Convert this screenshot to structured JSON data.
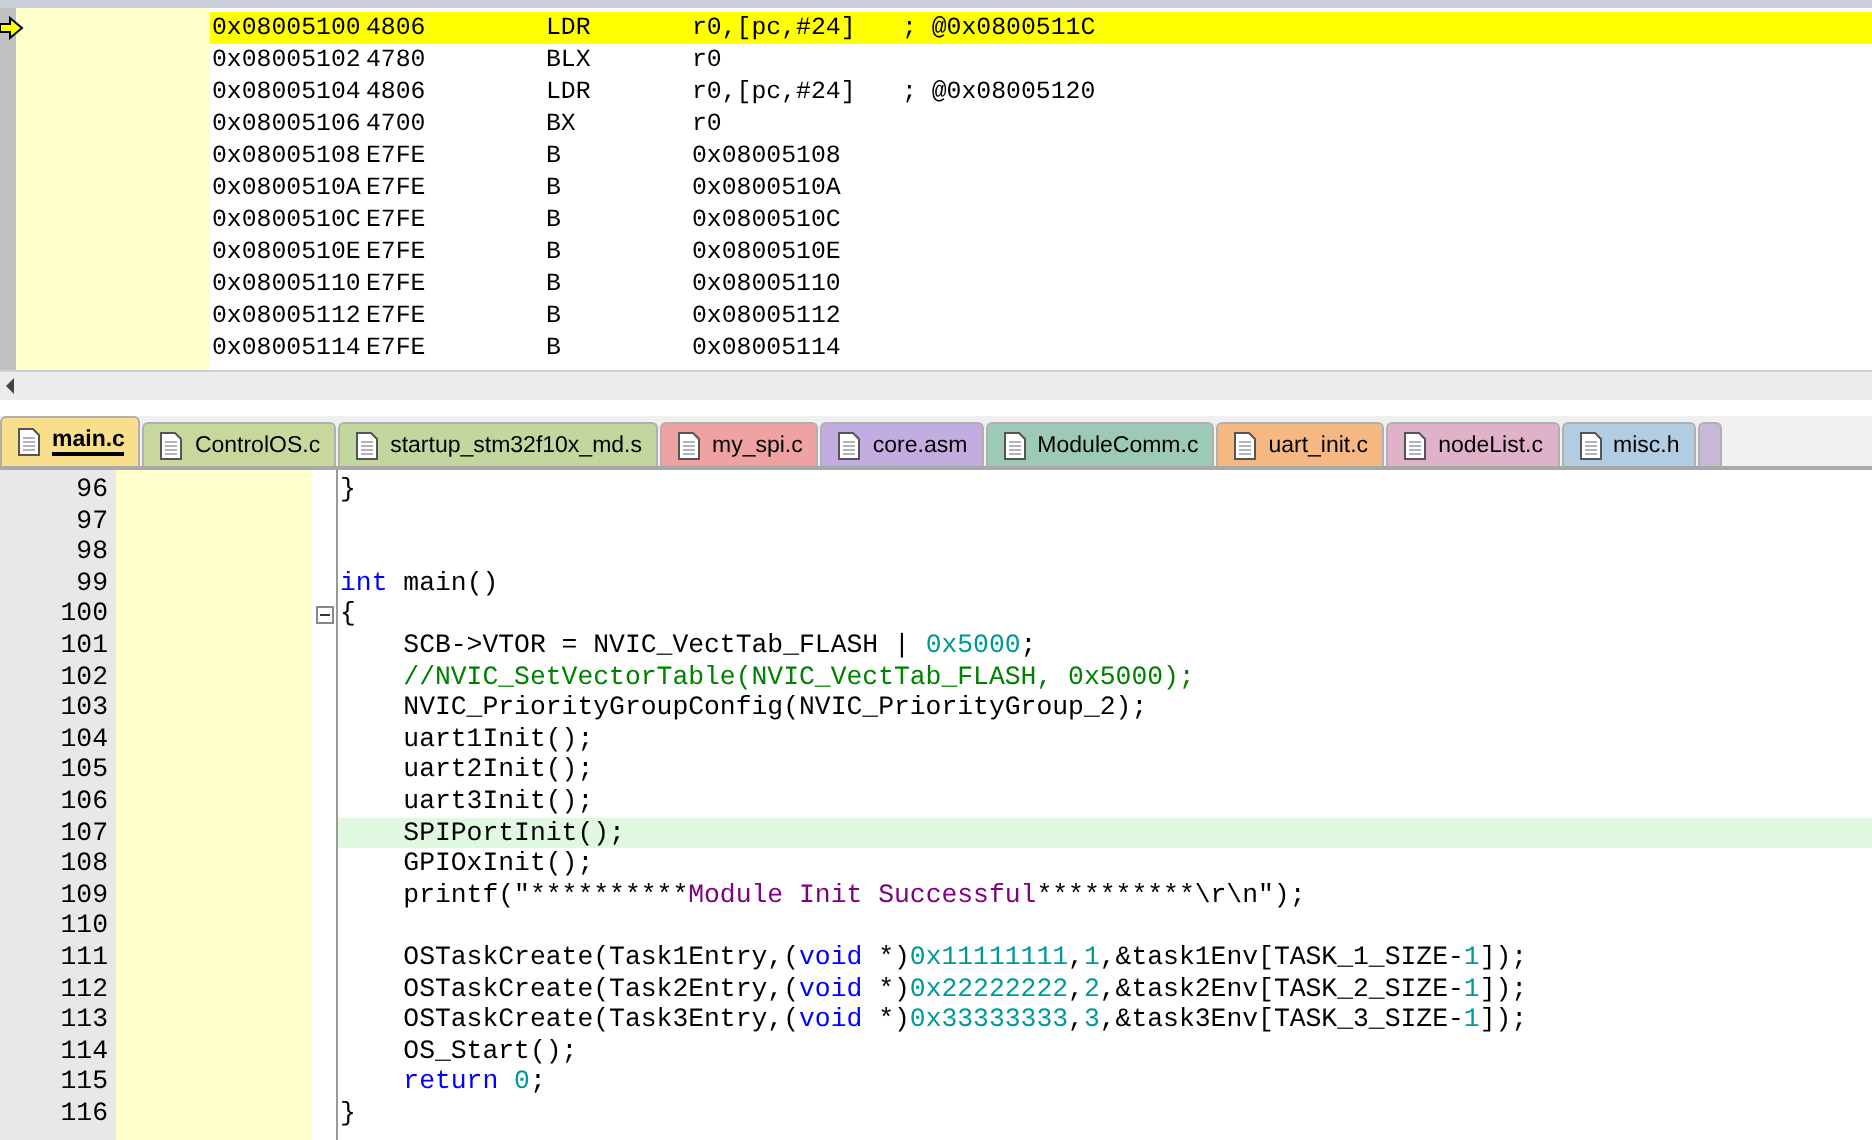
{
  "disassembly": {
    "rows": [
      {
        "address": "0x08005100",
        "opcode": "4806",
        "mnemonic": "LDR",
        "operands": "r0,[pc,#24]",
        "comment": "; @0x0800511C",
        "current": true
      },
      {
        "address": "0x08005102",
        "opcode": "4780",
        "mnemonic": "BLX",
        "operands": "r0",
        "current": false
      },
      {
        "address": "0x08005104",
        "opcode": "4806",
        "mnemonic": "LDR",
        "operands": "r0,[pc,#24]",
        "comment": "; @0x08005120",
        "current": false
      },
      {
        "address": "0x08005106",
        "opcode": "4700",
        "mnemonic": "BX",
        "operands": "r0",
        "current": false
      },
      {
        "address": "0x08005108",
        "opcode": "E7FE",
        "mnemonic": "B",
        "operands": "0x08005108",
        "current": false
      },
      {
        "address": "0x0800510A",
        "opcode": "E7FE",
        "mnemonic": "B",
        "operands": "0x0800510A",
        "current": false
      },
      {
        "address": "0x0800510C",
        "opcode": "E7FE",
        "mnemonic": "B",
        "operands": "0x0800510C",
        "current": false
      },
      {
        "address": "0x0800510E",
        "opcode": "E7FE",
        "mnemonic": "B",
        "operands": "0x0800510E",
        "current": false
      },
      {
        "address": "0x08005110",
        "opcode": "E7FE",
        "mnemonic": "B",
        "operands": "0x08005110",
        "current": false
      },
      {
        "address": "0x08005112",
        "opcode": "E7FE",
        "mnemonic": "B",
        "operands": "0x08005112",
        "current": false
      },
      {
        "address": "0x08005114",
        "opcode": "E7FE",
        "mnemonic": "B",
        "operands": "0x08005114",
        "current": false
      }
    ]
  },
  "tabs": [
    {
      "label": "main.c",
      "selected": true,
      "color": "#f9df8c"
    },
    {
      "label": "ControlOS.c",
      "selected": false,
      "color": "#c8d89c"
    },
    {
      "label": "startup_stm32f10x_md.s",
      "selected": false,
      "color": "#c2d79e"
    },
    {
      "label": "my_spi.c",
      "selected": false,
      "color": "#eea2a2"
    },
    {
      "label": "core.asm",
      "selected": false,
      "color": "#c3ace0"
    },
    {
      "label": "ModuleComm.c",
      "selected": false,
      "color": "#9dcab6"
    },
    {
      "label": "uart_init.c",
      "selected": false,
      "color": "#f6b882"
    },
    {
      "label": "nodeList.c",
      "selected": false,
      "color": "#dfb2c9"
    },
    {
      "label": "misc.h",
      "selected": false,
      "color": "#b2cde2"
    }
  ],
  "editor": {
    "lines": [
      {
        "number": "96",
        "fold": false,
        "highlighted": false,
        "tokens": [
          {
            "text": "}",
            "kind": "plain"
          }
        ]
      },
      {
        "number": "97",
        "fold": false
      },
      {
        "number": "98",
        "fold": false
      },
      {
        "number": "99",
        "fold": false,
        "highlighted": false,
        "tokens": [
          {
            "text": "int",
            "kind": "keyword"
          },
          {
            "text": " main()",
            "kind": "plain"
          }
        ]
      },
      {
        "number": "100",
        "fold": true,
        "highlighted": false,
        "tokens": [
          {
            "text": "{",
            "kind": "plain"
          }
        ]
      },
      {
        "number": "101",
        "fold": false,
        "highlighted": false,
        "tokens": [
          {
            "text": "    SCB->VTOR = NVIC_VectTab_FLASH | ",
            "kind": "plain"
          },
          {
            "text": "0x5000",
            "kind": "number"
          },
          {
            "text": ";",
            "kind": "plain"
          }
        ]
      },
      {
        "number": "102",
        "fold": false,
        "highlighted": false,
        "tokens": [
          {
            "text": "    //NVIC_SetVectorTable(NVIC_VectTab_FLASH, 0x5000);",
            "kind": "comment"
          }
        ]
      },
      {
        "number": "103",
        "fold": false,
        "highlighted": false,
        "tokens": [
          {
            "text": "    NVIC_PriorityGroupConfig(NVIC_PriorityGroup_2);",
            "kind": "plain"
          }
        ]
      },
      {
        "number": "104",
        "fold": false,
        "highlighted": false,
        "tokens": [
          {
            "text": "    uart1Init();",
            "kind": "plain"
          }
        ]
      },
      {
        "number": "105",
        "fold": false,
        "highlighted": false,
        "tokens": [
          {
            "text": "    uart2Init();",
            "kind": "plain"
          }
        ]
      },
      {
        "number": "106",
        "fold": false,
        "highlighted": false,
        "tokens": [
          {
            "text": "    uart3Init();",
            "kind": "plain"
          }
        ]
      },
      {
        "number": "107",
        "fold": false,
        "highlighted": true,
        "tokens": [
          {
            "text": "    SPIPortInit();",
            "kind": "plain"
          }
        ]
      },
      {
        "number": "108",
        "fold": false,
        "highlighted": false,
        "tokens": [
          {
            "text": "    GPIOxInit();",
            "kind": "plain"
          }
        ]
      },
      {
        "number": "109",
        "fold": false,
        "highlighted": false,
        "tokens": [
          {
            "text": "    printf(\"**********",
            "kind": "plain"
          },
          {
            "text": "Module Init Successful",
            "kind": "string"
          },
          {
            "text": "**********\\r\\n\");",
            "kind": "plain"
          }
        ]
      },
      {
        "number": "110",
        "fold": false
      },
      {
        "number": "111",
        "fold": false,
        "highlighted": false,
        "tokens": [
          {
            "text": "    OSTaskCreate(Task1Entry,(",
            "kind": "plain"
          },
          {
            "text": "void",
            "kind": "keyword"
          },
          {
            "text": " *)",
            "kind": "plain"
          },
          {
            "text": "0x11111111",
            "kind": "number"
          },
          {
            "text": ",",
            "kind": "plain"
          },
          {
            "text": "1",
            "kind": "number"
          },
          {
            "text": ",&task1Env[TASK_1_SIZE-",
            "kind": "plain"
          },
          {
            "text": "1",
            "kind": "number"
          },
          {
            "text": "]);",
            "kind": "plain"
          }
        ]
      },
      {
        "number": "112",
        "fold": false,
        "highlighted": false,
        "tokens": [
          {
            "text": "    OSTaskCreate(Task2Entry,(",
            "kind": "plain"
          },
          {
            "text": "void",
            "kind": "keyword"
          },
          {
            "text": " *)",
            "kind": "plain"
          },
          {
            "text": "0x22222222",
            "kind": "number"
          },
          {
            "text": ",",
            "kind": "plain"
          },
          {
            "text": "2",
            "kind": "number"
          },
          {
            "text": ",&task2Env[TASK_2_SIZE-",
            "kind": "plain"
          },
          {
            "text": "1",
            "kind": "number"
          },
          {
            "text": "]);",
            "kind": "plain"
          }
        ]
      },
      {
        "number": "113",
        "fold": false,
        "highlighted": false,
        "tokens": [
          {
            "text": "    OSTaskCreate(Task3Entry,(",
            "kind": "plain"
          },
          {
            "text": "void",
            "kind": "keyword"
          },
          {
            "text": " *)",
            "kind": "plain"
          },
          {
            "text": "0x33333333",
            "kind": "number"
          },
          {
            "text": ",",
            "kind": "plain"
          },
          {
            "text": "3",
            "kind": "number"
          },
          {
            "text": ",&task3Env[TASK_3_SIZE-",
            "kind": "plain"
          },
          {
            "text": "1",
            "kind": "number"
          },
          {
            "text": "]);",
            "kind": "plain"
          }
        ]
      },
      {
        "number": "114",
        "fold": false,
        "highlighted": false,
        "tokens": [
          {
            "text": "    OS_Start();",
            "kind": "plain"
          }
        ]
      },
      {
        "number": "115",
        "fold": false,
        "highlighted": false,
        "tokens": [
          {
            "text": "    return",
            "kind": "keyword"
          },
          {
            "text": " 0",
            "kind": "number"
          },
          {
            "text": ";",
            "kind": "plain"
          }
        ]
      },
      {
        "number": "116",
        "fold": false,
        "highlighted": false,
        "tokens": [
          {
            "text": "}",
            "kind": "plain"
          }
        ]
      }
    ]
  }
}
